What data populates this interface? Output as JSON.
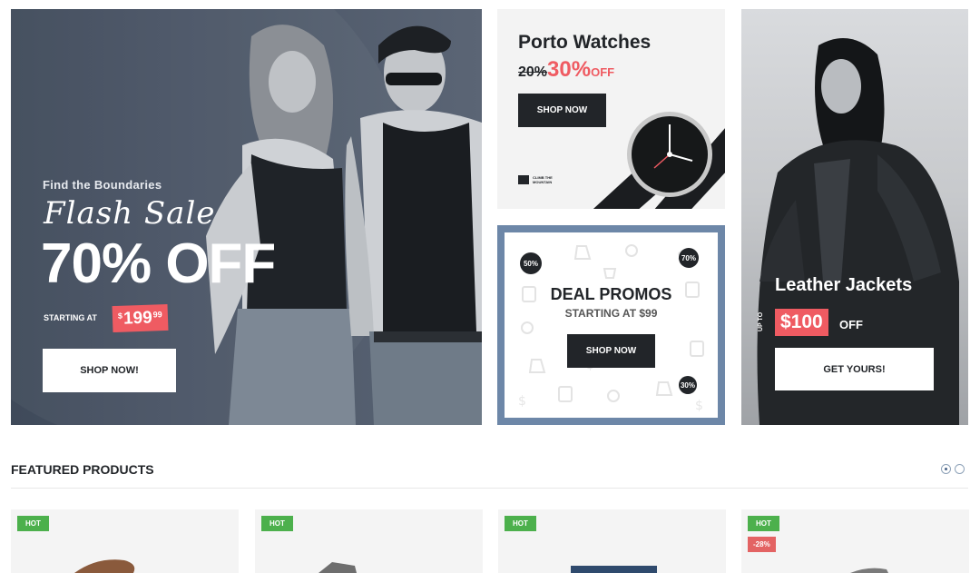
{
  "banners": {
    "flash_sale": {
      "subtitle": "Find the Boundaries",
      "script_title": "Flash Sale",
      "headline": "70% OFF",
      "starting_label": "STARTING AT",
      "price_currency": "$",
      "price_main": "199",
      "price_cents": "99",
      "button_label": "SHOP NOW!"
    },
    "watches": {
      "title": "Porto Watches",
      "old_percent": "20%",
      "new_percent": "30%",
      "off_label": "OFF",
      "button_label": "SHOP NOW",
      "brand_text": "CLIMB THE MOUNTAIN"
    },
    "deal_promos": {
      "title": "DEAL PROMOS",
      "subtitle": "STARTING AT $99",
      "button_label": "SHOP NOW",
      "badges": [
        "50%",
        "70%",
        "30%"
      ],
      "frame_color": "#6d87a8"
    },
    "jackets": {
      "title": "Leather Jackets",
      "upto_label": "UP TO",
      "price": "$100",
      "off_label": "OFF",
      "button_label": "GET YOURS!"
    }
  },
  "featured": {
    "title": "FEATURED PRODUCTS",
    "carousel_dots": 2,
    "active_dot": 0,
    "products": [
      {
        "labels": [
          "HOT"
        ]
      },
      {
        "labels": [
          "HOT"
        ]
      },
      {
        "labels": [
          "HOT"
        ]
      },
      {
        "labels": [
          "HOT",
          "-28%"
        ]
      }
    ]
  },
  "colors": {
    "accent_red": "#ef5b62",
    "dark": "#222529",
    "hot_green": "#4cb04c",
    "sale_red": "#e36363"
  }
}
